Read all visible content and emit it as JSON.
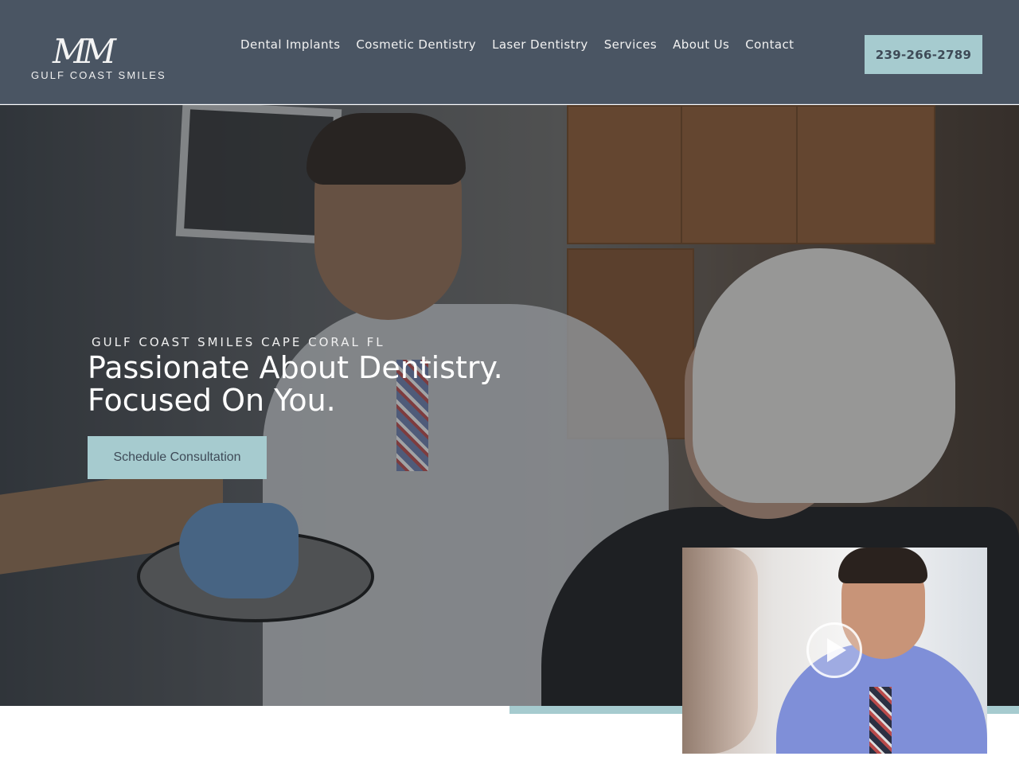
{
  "brand": {
    "logo_mark": "MM",
    "logo_sub": "GULF COAST SMILES"
  },
  "nav": {
    "items": [
      {
        "label": "Dental Implants"
      },
      {
        "label": "Cosmetic Dentistry"
      },
      {
        "label": "Laser Dentistry"
      },
      {
        "label": "Services"
      },
      {
        "label": "About Us"
      },
      {
        "label": "Contact"
      }
    ],
    "phone": "239-266-2789"
  },
  "hero": {
    "eyebrow": "GULF COAST SMILES CAPE CORAL FL",
    "title_line1": "Passionate About Dentistry.",
    "title_line2": "Focused On You.",
    "cta_label": "Schedule Consultation"
  },
  "video": {
    "icon": "play-icon"
  },
  "colors": {
    "header_bg": "#4a5563",
    "accent": "#a6cbcf",
    "text_light": "#ffffff"
  }
}
